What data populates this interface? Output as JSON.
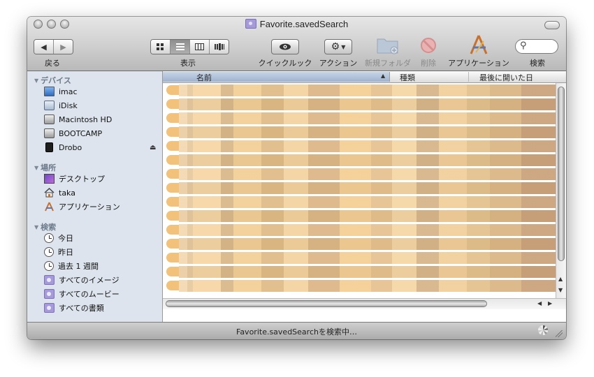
{
  "window": {
    "title": "Favorite.savedSearch"
  },
  "toolbar": {
    "back_label": "戻る",
    "view_label": "表示",
    "quicklook_label": "クイックルック",
    "action_label": "アクション",
    "newfolder_label": "新規フォルダ",
    "delete_label": "削除",
    "apps_label": "アプリケーション",
    "search_label": "検索",
    "back_glyph": "◀",
    "forward_glyph": "▶"
  },
  "sidebar": {
    "devices_header": "デバイス",
    "devices": [
      {
        "label": "imac",
        "icon": "imac-icon"
      },
      {
        "label": "iDisk",
        "icon": "idisk-icon"
      },
      {
        "label": "Macintosh HD",
        "icon": "harddisk-icon"
      },
      {
        "label": "BOOTCAMP",
        "icon": "harddisk-icon"
      },
      {
        "label": "Drobo",
        "icon": "drobo-icon"
      }
    ],
    "places_header": "場所",
    "places": [
      {
        "label": "デスクトップ",
        "icon": "desktop-icon"
      },
      {
        "label": "taka",
        "icon": "home-icon"
      },
      {
        "label": "アプリケーション",
        "icon": "applications-icon"
      }
    ],
    "search_header": "検索",
    "searches": [
      {
        "label": "今日",
        "icon": "clock-icon"
      },
      {
        "label": "昨日",
        "icon": "clock-icon"
      },
      {
        "label": "過去 1 週間",
        "icon": "clock-icon"
      },
      {
        "label": "すべてのイメージ",
        "icon": "smart-folder-icon"
      },
      {
        "label": "すべてのムービー",
        "icon": "smart-folder-icon"
      },
      {
        "label": "すべての書類",
        "icon": "smart-folder-icon"
      }
    ]
  },
  "list": {
    "columns": [
      "名前",
      "種類",
      "最後に開いた日"
    ],
    "sort_indicator": "▲",
    "row_count": 15
  },
  "status": {
    "text": "Favorite.savedSearchを検索中…"
  }
}
